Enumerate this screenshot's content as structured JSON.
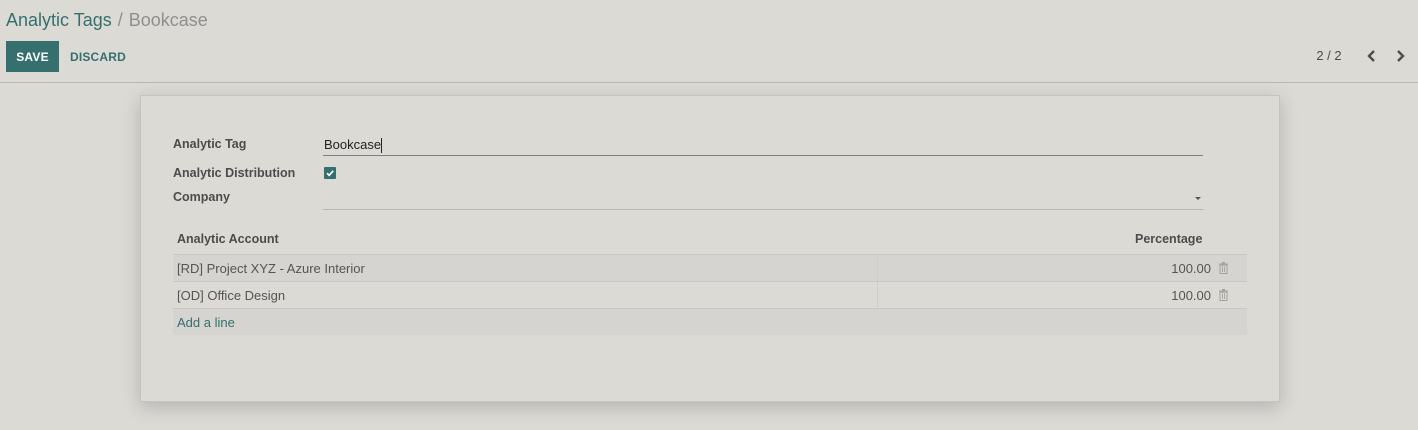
{
  "breadcrumb": {
    "parent": "Analytic Tags",
    "separator": "/",
    "current": "Bookcase"
  },
  "buttons": {
    "save": "SAVE",
    "discard": "DISCARD"
  },
  "pager": {
    "value": "2 / 2",
    "prev_icon": "chevron-left-icon",
    "next_icon": "chevron-right-icon"
  },
  "form": {
    "analytic_tag_label": "Analytic Tag",
    "analytic_tag_value": "Bookcase",
    "analytic_distribution_label": "Analytic Distribution",
    "analytic_distribution_checked": true,
    "company_label": "Company",
    "company_value": ""
  },
  "distribution_table": {
    "columns": {
      "account": "Analytic Account",
      "percentage": "Percentage"
    },
    "rows": [
      {
        "account": "[RD] Project XYZ - Azure Interior",
        "percentage": "100.00"
      },
      {
        "account": "[OD] Office Design",
        "percentage": "100.00"
      }
    ],
    "add_line": "Add a line"
  },
  "colors": {
    "primary": "#35706e",
    "background": "#dcdad5"
  }
}
